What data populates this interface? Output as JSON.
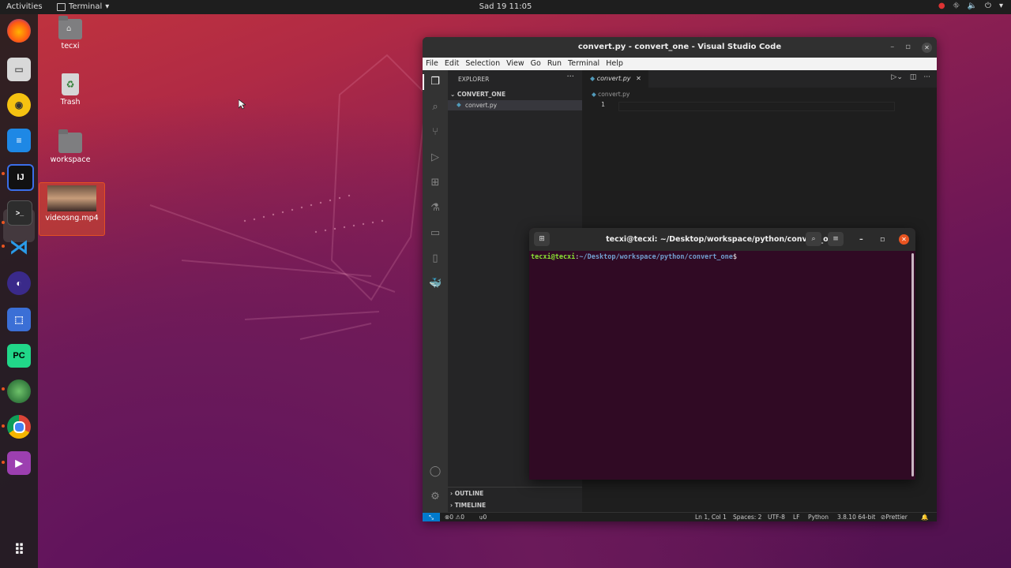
{
  "topbar": {
    "activities": "Activities",
    "app_name": "Terminal",
    "clock": "Sad 19  11:05"
  },
  "dock": {
    "items": [
      "firefox",
      "files",
      "rhythmbox",
      "writer",
      "intellij",
      "terminal",
      "vscode",
      "eclipse",
      "screenshot",
      "pycharm",
      "earth",
      "chrome",
      "media-player"
    ],
    "show_apps_label": "show-applications"
  },
  "desktop": {
    "icons": [
      {
        "label": "tecxi",
        "type": "home-folder"
      },
      {
        "label": "Trash",
        "type": "trash"
      },
      {
        "label": "workspace",
        "type": "folder"
      },
      {
        "label": "videosng.mp4",
        "type": "video"
      }
    ]
  },
  "vscode": {
    "title": "convert.py - convert_one - Visual Studio Code",
    "menu": [
      "File",
      "Edit",
      "Selection",
      "View",
      "Go",
      "Run",
      "Terminal",
      "Help"
    ],
    "explorer_label": "EXPLORER",
    "folder_name": "CONVERT_ONE",
    "file_name": "convert.py",
    "tab_label": "convert.py",
    "breadcrumb": "convert.py",
    "line_number": "1",
    "outline_label": "OUTLINE",
    "timeline_label": "TIMELINE",
    "status": {
      "errors": "0",
      "warnings": "0",
      "ports": "0",
      "position": "Ln 1, Col 1",
      "spaces": "Spaces: 2",
      "encoding": "UTF-8",
      "eol": "LF",
      "language": "Python",
      "interpreter": "3.8.10 64-bit",
      "formatter": "Prettier"
    }
  },
  "terminal": {
    "title": "tecxi@tecxi: ~/Desktop/workspace/python/convert_one",
    "prompt_user": "tecxi@tecxi",
    "prompt_sep": ":",
    "prompt_path": "~/Desktop/workspace/python/convert_one",
    "prompt_symbol": "$"
  },
  "colors": {
    "ubuntu_orange": "#e95420",
    "terminal_bg": "#300a24",
    "prompt_user": "#8ae234",
    "prompt_path": "#729fcf",
    "vscode_accent": "#007acc"
  }
}
